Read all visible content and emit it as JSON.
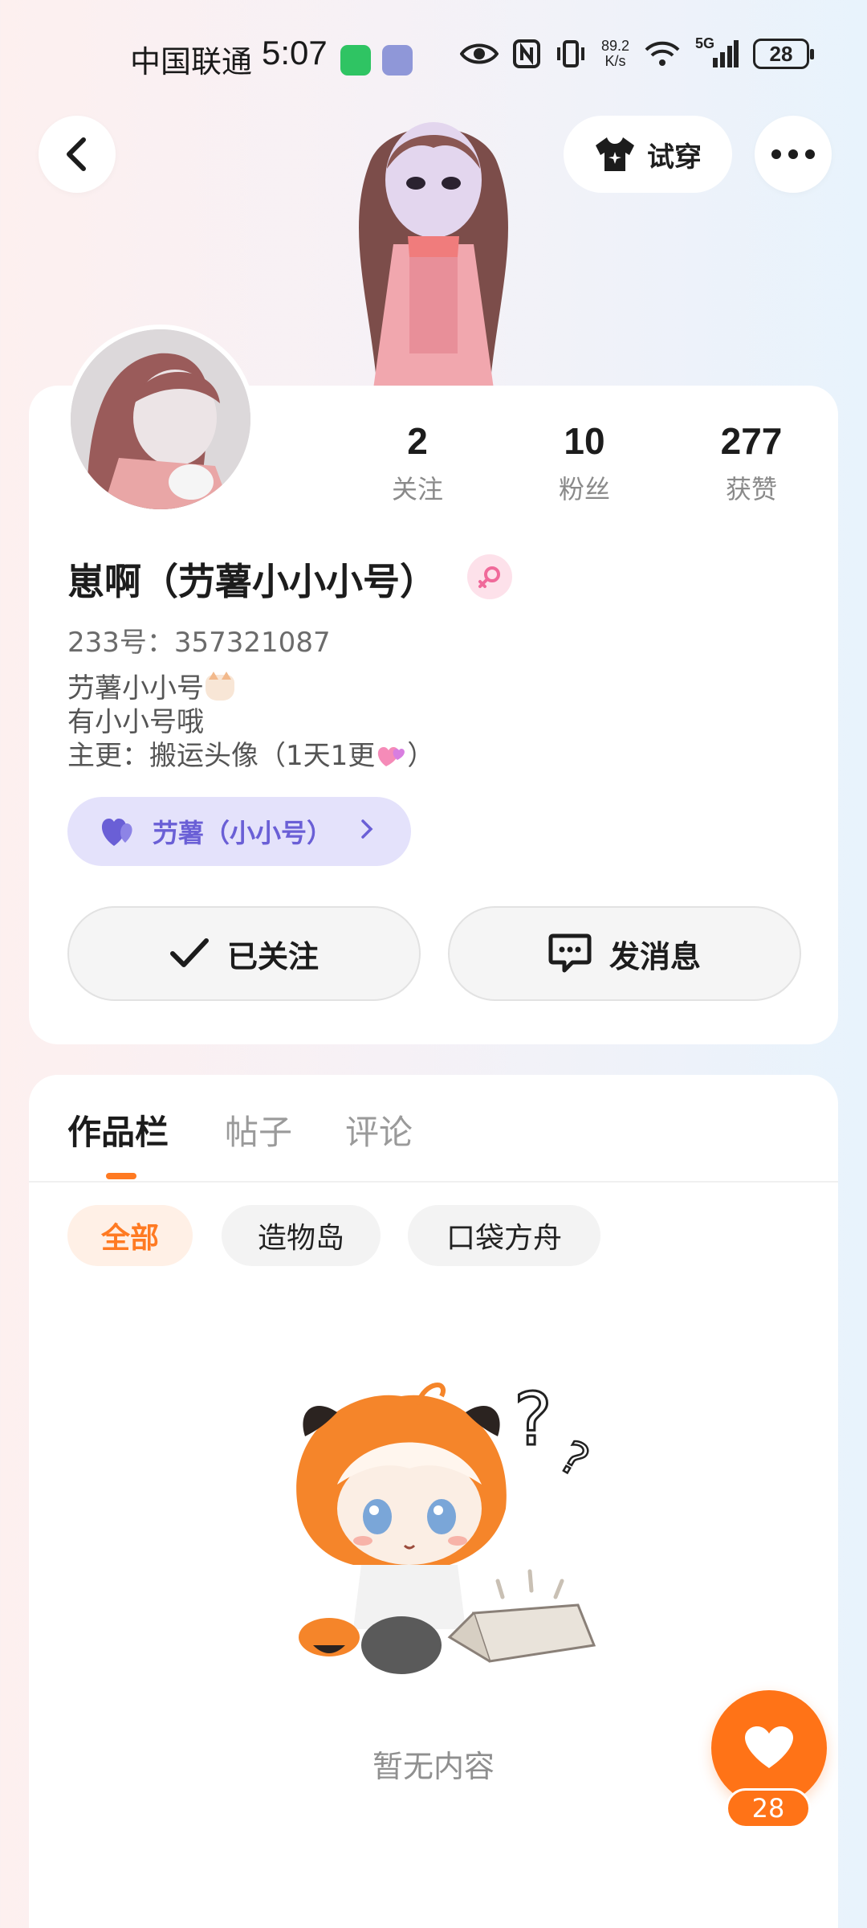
{
  "status_bar": {
    "carrier": "中国联通",
    "time": "5:07",
    "net_speed_value": "89.2",
    "net_speed_unit": "K/s",
    "network": "5G",
    "battery": "28"
  },
  "header": {
    "back_icon": "chevron-left-icon",
    "try_on_label": "试穿",
    "try_on_icon": "shirt-icon",
    "more_icon": "more-horizontal-icon"
  },
  "profile": {
    "stats": [
      {
        "value": "2",
        "label": "关注"
      },
      {
        "value": "10",
        "label": "粉丝"
      },
      {
        "value": "277",
        "label": "获赞"
      }
    ],
    "username": "崽啊（芀薯小小小号）",
    "gender": "female",
    "user_id": "233号：357321087",
    "bio_lines": [
      "芀薯小小号",
      "有小小号哦",
      "主更：搬运头像（1天1更"
    ],
    "bio_close": "）",
    "group_chip": "芀薯（小小号）",
    "follow_label": "已关注",
    "message_label": "发消息"
  },
  "works": {
    "tabs": [
      "作品栏",
      "帖子",
      "评论"
    ],
    "active_tab": 0,
    "filters": [
      "全部",
      "造物岛",
      "口袋方舟"
    ],
    "active_filter": 0,
    "empty_text": "暂无内容"
  },
  "like_fab": {
    "count": "28"
  },
  "colors": {
    "accent": "#ff7317",
    "chip_purple": "#6a5fd6",
    "chip_bg": "#e4e2fb"
  }
}
